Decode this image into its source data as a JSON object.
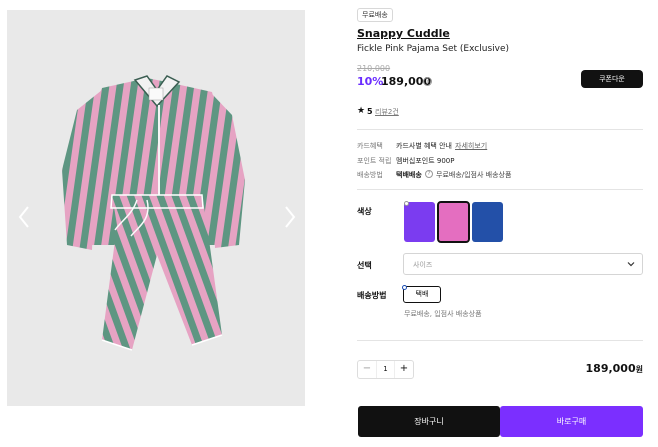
{
  "product": {
    "badge": "무료배송",
    "brand": "Snappy Cuddle",
    "name": "Fickle Pink Pajama Set (Exclusive)",
    "original_price": "210,000",
    "discount": "10%",
    "price": "189,000",
    "coupon_label": "쿠폰다운",
    "rating": "5",
    "review_link": "리뷰2건"
  },
  "benefits": {
    "card_label": "카드혜택",
    "card_value": "카드사별 혜택 안내",
    "card_link": "자세히보기",
    "point_label": "포인트 적립",
    "point_value": "멤버십포인트 900P",
    "shipping_label": "배송방법",
    "shipping_value": "택배배송",
    "shipping_desc": "무료배송/입점사 배송상품"
  },
  "options": {
    "color_label": "색상",
    "colors": [
      "#7b3cf0",
      "#e46ec0",
      "#2350a8"
    ],
    "selected_color_index": 1,
    "select_label": "선택",
    "select_placeholder": "사이즈",
    "shipping_label": "배송방법",
    "shipping_option": "택배",
    "shipping_sub": "무료배송, 입점사 배송상품"
  },
  "order": {
    "minus": "−",
    "quantity": "1",
    "plus": "+",
    "total": "189,000",
    "total_unit": "원",
    "cart_label": "장바구니",
    "buy_label": "바로구매"
  },
  "colors": {
    "accent": "#7b2fff",
    "dark": "#111111",
    "stripe_pink": "#e6a3c3",
    "stripe_green": "#5e9682"
  }
}
